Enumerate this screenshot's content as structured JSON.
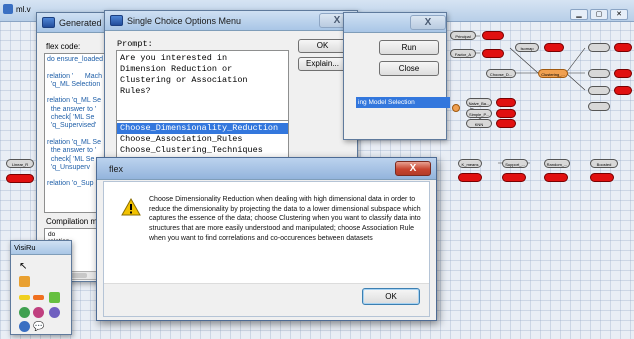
{
  "background_window": {
    "title": "ml.v",
    "node_labels": [
      "Principal",
      "Factor_A",
      "Isomap",
      "Clustering_...",
      "Choose_D...",
      "Naive_Ba...",
      "Simple_P...",
      "KNN",
      "K_means",
      "Support_...",
      "Random_...",
      "Boosted",
      "Linear_R"
    ],
    "status_label": "ing Model Selection"
  },
  "generated_code_window": {
    "title": "Generated co",
    "flex_code_label": "flex code:",
    "code_lines": [
      "do ensure_loaded",
      "",
      "relation '      Mach",
      "  'q_ML Selection",
      "",
      "relation 'q_ML Se",
      "  the answer to '",
      "  check[ 'ML Se",
      "  'q_Supervised'",
      "",
      "relation 'q_ML Se",
      "  the answer to '",
      "  check[ 'ML Se",
      "  'q_Unsuperv",
      "",
      "relation 'o_Sup"
    ],
    "compilation_label": "Compilation me",
    "compilation_lines": [
      "do",
      "relation",
      "relation",
      "relation",
      "relation",
      "relation"
    ]
  },
  "visirule_palette": {
    "title": "VisiRu"
  },
  "options_window": {
    "title": "Single Choice Options Menu",
    "close_label": "X",
    "prompt_label": "Prompt:",
    "prompt_text": "Are you interested in\nDimension Reduction or\nClustering or Association\nRules?",
    "ok_label": "OK",
    "explain_label": "Explain...",
    "options": [
      "Choose_Dimensionality_Reduction",
      "Choose_Association_Rules",
      "Choose_Clustering_Techniques"
    ],
    "selected_index": 0
  },
  "run_panel": {
    "run_label": "Run",
    "close_label": "Close",
    "close_x": "X"
  },
  "flex_dialog": {
    "title": "flex",
    "close_label": "X",
    "message": "Choose Dimensionality Reduction when dealing with high dimensional data in order to reduce the dimensionality by projecting the data to a lower dimensional subspace which captures the essence of the data; choose Clustering when you want to classify data into structures that are more easily understood and manipulated; choose Association Rule when you want to find correlations and co-occurences between datasets",
    "ok_label": "OK",
    "icon": "warning-icon"
  },
  "colors": {
    "selection": "#3377dd",
    "node_red": "#e01010",
    "close_red": "#c84530"
  }
}
